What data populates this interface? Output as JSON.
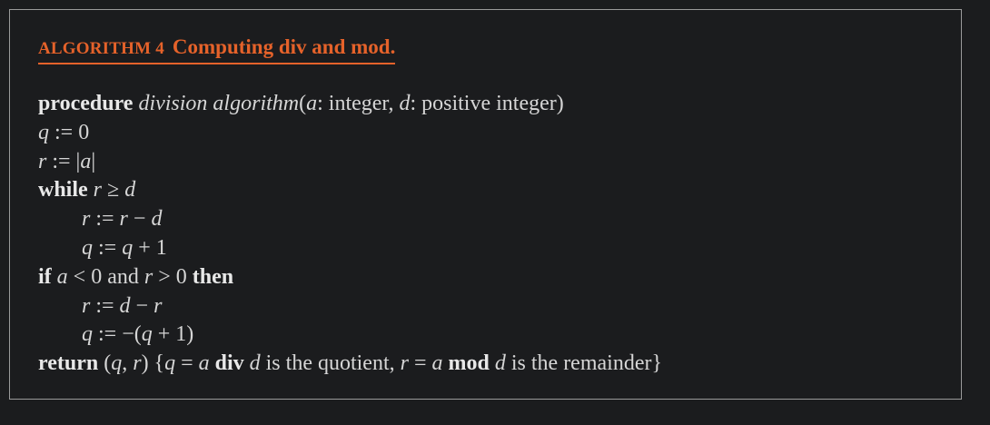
{
  "algorithm": {
    "label": "ALGORITHM 4",
    "title": "Computing div and mod."
  },
  "lines": {
    "l1": {
      "kw": "procedure",
      "name": "division algorithm",
      "p1": "(",
      "a": "a",
      "p2": ":  integer, ",
      "d": "d",
      "p3": ":  positive integer)"
    },
    "l2": {
      "var": "q",
      "rest": " := 0"
    },
    "l3": {
      "var": "r",
      "op": " := |",
      "a": "a",
      "close": "|"
    },
    "l4": {
      "kw": "while",
      "r": "r",
      "op": " ≥ ",
      "d": "d"
    },
    "l5": {
      "r1": "r",
      "op1": " := ",
      "r2": "r",
      "op2": " − ",
      "d": "d"
    },
    "l6": {
      "q1": "q",
      "op1": " := ",
      "q2": "q",
      "op2": " + 1"
    },
    "l7": {
      "kw_if": "if",
      "a": "a",
      "t1": " < 0 and ",
      "r": "r",
      "t2": " > 0 ",
      "kw_then": "then"
    },
    "l8": {
      "r1": "r",
      "op1": " := ",
      "d": "d",
      "op2": " − ",
      "r2": "r"
    },
    "l9": {
      "q1": "q",
      "op1": " := −(",
      "q2": "q",
      "op2": " + 1)"
    },
    "l10": {
      "kw": "return",
      "t1": " (",
      "q": "q",
      "t2": ", ",
      "r": "r",
      "t3": ") {",
      "q2": "q",
      "t4": " = ",
      "a": "a",
      "t5": " ",
      "kw_div": "div",
      "t6": " ",
      "d": "d",
      "t7": " is the quotient, ",
      "r2": "r",
      "t8": " = ",
      "a2": "a",
      "t9": " ",
      "kw_mod": "mod",
      "t10": " ",
      "d2": "d",
      "t11": " is the remainder}"
    }
  }
}
